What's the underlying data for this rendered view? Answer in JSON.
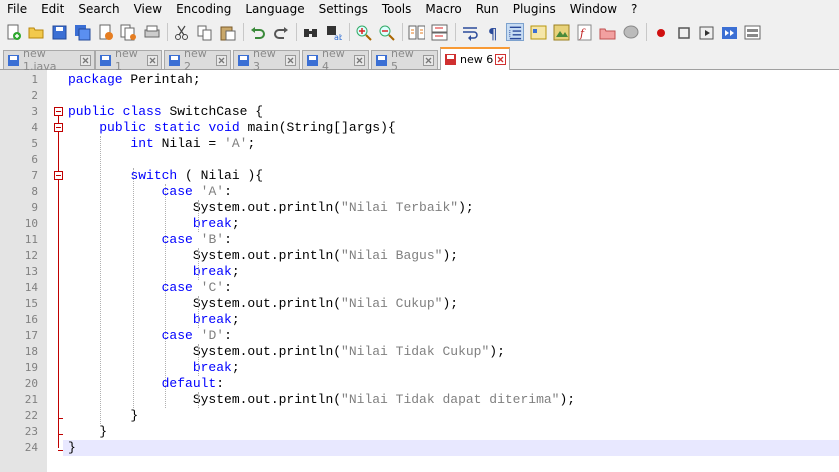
{
  "menu": [
    "File",
    "Edit",
    "Search",
    "View",
    "Encoding",
    "Language",
    "Settings",
    "Tools",
    "Macro",
    "Run",
    "Plugins",
    "Window",
    "?"
  ],
  "tabs": [
    {
      "label": "new 1.java",
      "active": false
    },
    {
      "label": "new 1",
      "active": false
    },
    {
      "label": "new 2",
      "active": false
    },
    {
      "label": "new 3",
      "active": false
    },
    {
      "label": "new 4",
      "active": false
    },
    {
      "label": "new 5",
      "active": false
    },
    {
      "label": "new 6",
      "active": true
    }
  ],
  "toolbar_icons": [
    "new-file-icon",
    "open-file-icon",
    "save-icon",
    "save-all-icon",
    "close-icon",
    "close-all-icon",
    "print-icon",
    "cut-icon",
    "copy-icon",
    "paste-icon",
    "undo-icon",
    "redo-icon",
    "find-icon",
    "replace-icon",
    "zoom-in-icon",
    "zoom-out-icon",
    "sync-vertical-icon",
    "sync-horizontal-icon",
    "word-wrap-icon",
    "show-all-chars-icon",
    "indent-guide-icon",
    "user-defined-language-icon",
    "document-map-icon",
    "function-list-icon",
    "folder-workspace-icon",
    "monitoring-icon",
    "record-macro-icon",
    "stop-recording-icon",
    "playback-macro-icon",
    "run-macro-multiple-icon",
    "save-macro-icon"
  ],
  "colors": {
    "keyword": "#0000ff",
    "string": "#808080",
    "fold_marker": "#c00000",
    "active_tab_accent": "#f89a35",
    "current_line": "#e8e8ff"
  },
  "editor": {
    "current_line": 24,
    "lines": [
      {
        "n": "1",
        "code": "package Perintah;"
      },
      {
        "n": "2",
        "code": ""
      },
      {
        "n": "3",
        "code": "public class SwitchCase {"
      },
      {
        "n": "4",
        "code": "    public static void main(String[]args){"
      },
      {
        "n": "5",
        "code": "        int Nilai = 'A';"
      },
      {
        "n": "6",
        "code": ""
      },
      {
        "n": "7",
        "code": "        switch ( Nilai ){"
      },
      {
        "n": "8",
        "code": "            case 'A':"
      },
      {
        "n": "9",
        "code": "                System.out.println(\"Nilai Terbaik\");"
      },
      {
        "n": "10",
        "code": "                break;"
      },
      {
        "n": "11",
        "code": "            case 'B':"
      },
      {
        "n": "12",
        "code": "                System.out.println(\"Nilai Bagus\");"
      },
      {
        "n": "13",
        "code": "                break;"
      },
      {
        "n": "14",
        "code": "            case 'C':"
      },
      {
        "n": "15",
        "code": "                System.out.println(\"Nilai Cukup\");"
      },
      {
        "n": "16",
        "code": "                break;"
      },
      {
        "n": "17",
        "code": "            case 'D':"
      },
      {
        "n": "18",
        "code": "                System.out.println(\"Nilai Tidak Cukup\");"
      },
      {
        "n": "19",
        "code": "                break;"
      },
      {
        "n": "20",
        "code": "            default:"
      },
      {
        "n": "21",
        "code": "                System.out.println(\"Nilai Tidak dapat diterima\");"
      },
      {
        "n": "22",
        "code": "        }"
      },
      {
        "n": "23",
        "code": "    }"
      },
      {
        "n": "24",
        "code": "}"
      }
    ]
  }
}
